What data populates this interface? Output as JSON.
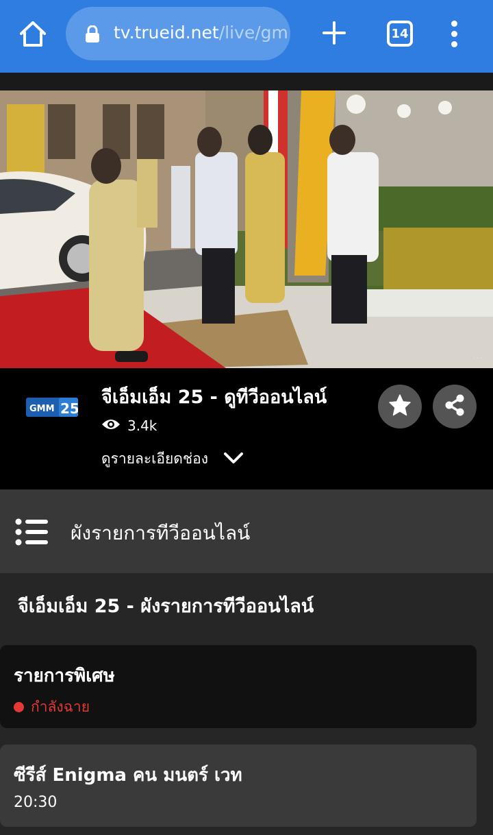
{
  "browser": {
    "url_domain": "tv.trueid.net",
    "url_path": "/live/gm",
    "tab_count": "14"
  },
  "player": {
    "more_indicator": "···"
  },
  "channel": {
    "logo_text": "GMM",
    "logo_number": "25",
    "title": "จีเอ็มเอ็ม 25 - ดูทีวีออนไลน์",
    "views": "3.4k",
    "details_label": "ดูรายละเอียดช่อง"
  },
  "schedule": {
    "header_label": "ผังรายการทีวีออนไลน์",
    "section_title": "จีเอ็มเอ็ม 25 - ผังรายการทีวีออนไลน์",
    "programs": [
      {
        "name": "รายการพิเศษ",
        "status": "กำลังฉาย"
      },
      {
        "name": "ซีรีส์ Enigma คน มนตร์ เวท",
        "time": "20:30"
      }
    ]
  },
  "colors": {
    "browser_bar": "#2f7de1",
    "live_red": "#e53935",
    "background": "#262626"
  }
}
